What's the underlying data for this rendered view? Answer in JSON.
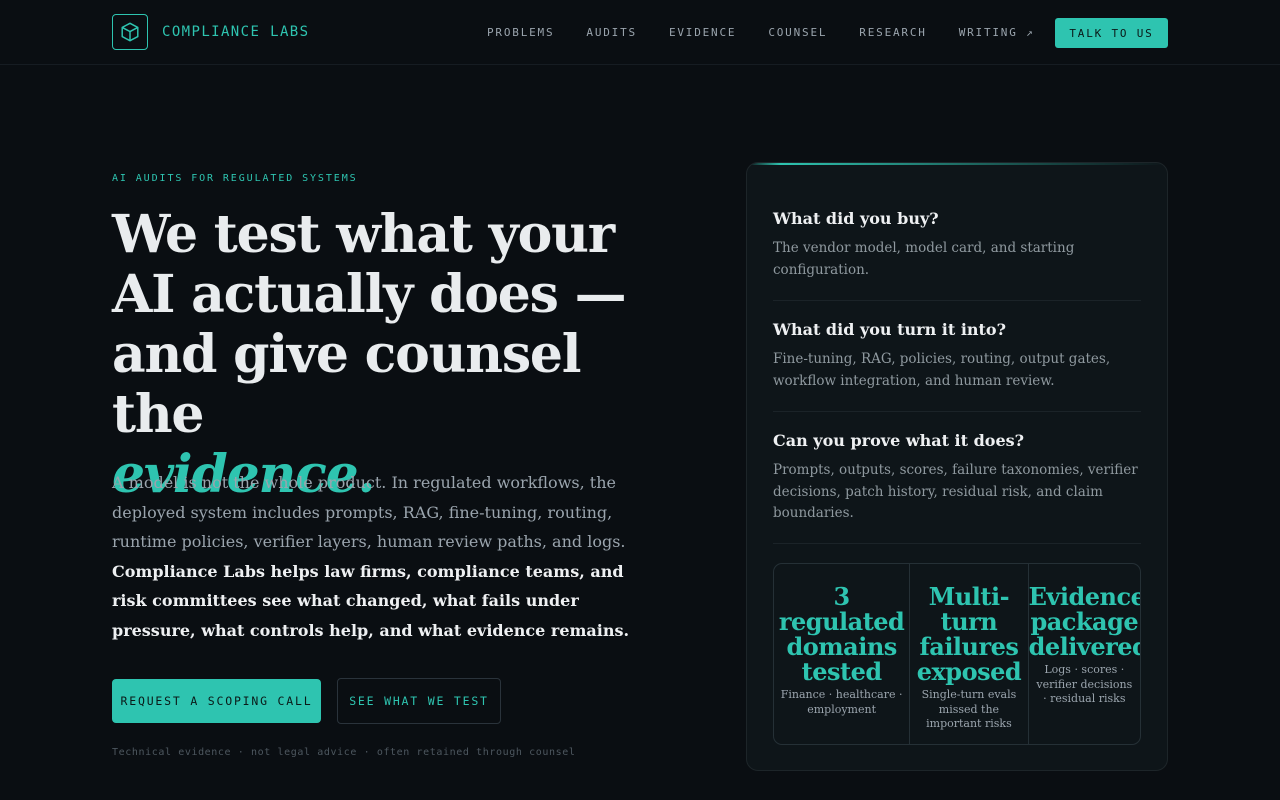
{
  "brand": {
    "name": "COMPLIANCE LABS",
    "logo_icon": "cube-icon"
  },
  "nav": {
    "items": [
      "PROBLEMS",
      "AUDITS",
      "EVIDENCE",
      "COUNSEL",
      "RESEARCH",
      "WRITING ↗"
    ],
    "cta": "TALK TO US"
  },
  "hero": {
    "eyebrow": "AI AUDITS FOR REGULATED SYSTEMS",
    "headline": "We test what your AI actually does — and give counsel the",
    "headline_accent": "evidence.",
    "lede": "A model is not the whole product. In regulated workflows, the deployed system includes prompts, RAG, fine-tuning, routing, runtime policies, verifier layers, human review paths, and logs.",
    "lede_strong": "Compliance Labs helps law firms, compliance teams, and risk committees see what changed, what fails under pressure, what controls help, and what evidence remains.",
    "primary_button": "REQUEST A SCOPING CALL",
    "secondary_button": "SEE WHAT WE TEST",
    "footnote": "Technical evidence · not legal advice · often retained through counsel"
  },
  "card": {
    "questions": [
      {
        "title": "What did you buy?",
        "body": "The vendor model, model card, and starting configuration."
      },
      {
        "title": "What did you turn it into?",
        "body": "Fine-tuning, RAG, policies, routing, output gates, workflow integration, and human review."
      },
      {
        "title": "Can you prove what it does?",
        "body": "Prompts, outputs, scores, failure taxonomies, verifier decisions, patch history, residual risk, and claim boundaries."
      }
    ],
    "stats": [
      {
        "big": "3\nregulated\ndomains\ntested",
        "small": "Finance · healthcare · employment"
      },
      {
        "big": "Multi-\nturn\nfailures\nexposed",
        "small": "Single-turn evals missed the important risks"
      },
      {
        "big": "Evidence\npackage\ndelivered",
        "small": "Logs · scores · verifier decisions · residual risks"
      }
    ]
  },
  "colors": {
    "accent": "#2ec4b0",
    "background": "#0a0e12",
    "card": "#0e1519"
  }
}
